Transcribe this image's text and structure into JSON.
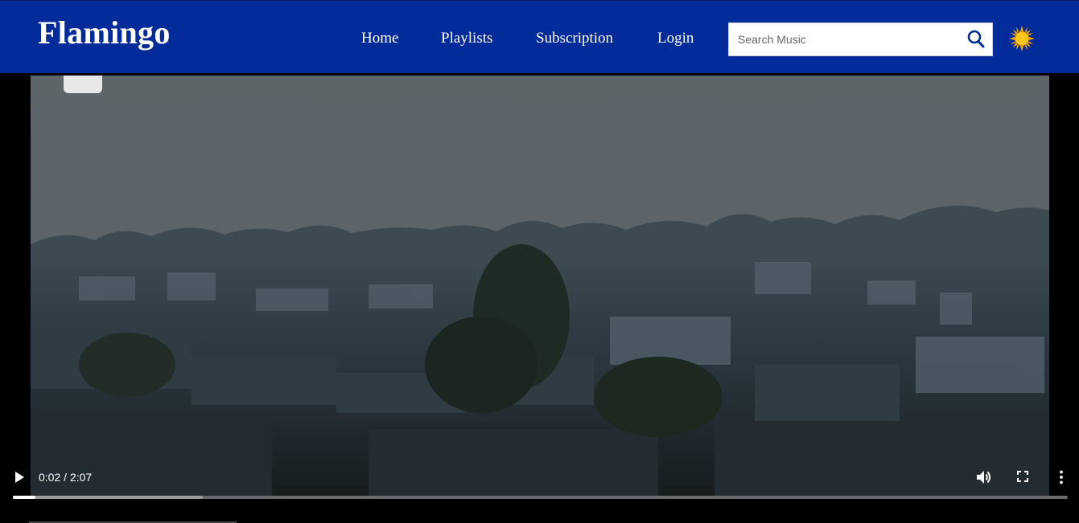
{
  "navbar": {
    "brand": "Flamingo",
    "links": [
      {
        "label": "Home"
      },
      {
        "label": "Playlists"
      },
      {
        "label": "Subscription"
      },
      {
        "label": "Login"
      }
    ],
    "search": {
      "placeholder": "Search Music",
      "value": ""
    },
    "colors": {
      "background": "#032b9a",
      "text": "#ffffff",
      "search_icon": "#032b9a",
      "sun_icon": "#f5b400"
    },
    "icons": {
      "search": "search-icon",
      "theme_toggle": "sun-icon"
    }
  },
  "video": {
    "current_time": "0:02",
    "duration": "2:07",
    "time_display": "0:02 / 2:07",
    "progress_fraction": 0.016,
    "buffered_fraction": 0.18,
    "icons": {
      "play": "play-icon",
      "volume": "volume-icon",
      "fullscreen": "fullscreen-icon",
      "more": "more-options-icon"
    }
  }
}
